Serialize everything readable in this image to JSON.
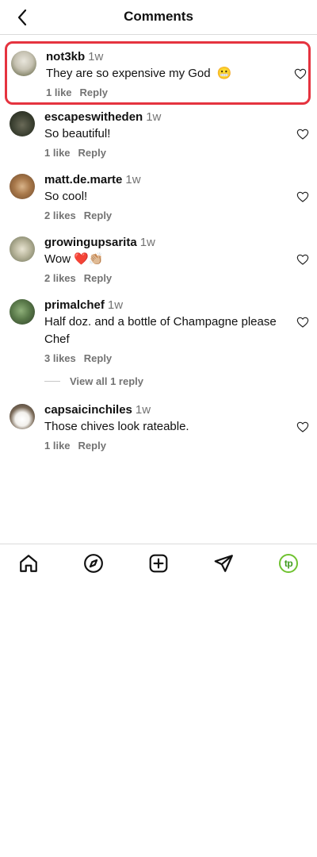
{
  "header": {
    "title": "Comments"
  },
  "comments": [
    {
      "username": "not3kb",
      "time": "1w",
      "text": "They are so expensive my God  😬",
      "likes": "1 like",
      "reply": "Reply"
    },
    {
      "username": "escapeswitheden",
      "time": "1w",
      "text": "So beautiful!",
      "likes": "1 like",
      "reply": "Reply"
    },
    {
      "username": "matt.de.marte",
      "time": "1w",
      "text": "So cool!",
      "likes": "2 likes",
      "reply": "Reply"
    },
    {
      "username": "growingupsarita",
      "time": "1w",
      "text": "Wow ❤️👏🏼",
      "likes": "2 likes",
      "reply": "Reply"
    },
    {
      "username": "primalchef",
      "time": "1w",
      "text": "Half doz. and a bottle of Champagne please Chef",
      "likes": "3 likes",
      "reply": "Reply"
    },
    {
      "username": "capsaicinchiles",
      "time": "1w",
      "text": "Those chives look rateable.",
      "likes": "1 like",
      "reply": "Reply"
    }
  ],
  "view_replies": "View all 1 reply",
  "nav": {
    "items": [
      "home-icon",
      "explore-icon",
      "create-icon",
      "direct-icon",
      "profile-icon"
    ],
    "profile_initials": "tp"
  },
  "colors": {
    "highlight": "#e5333f",
    "profile_ring": "#6fc230",
    "muted": "#737373"
  }
}
